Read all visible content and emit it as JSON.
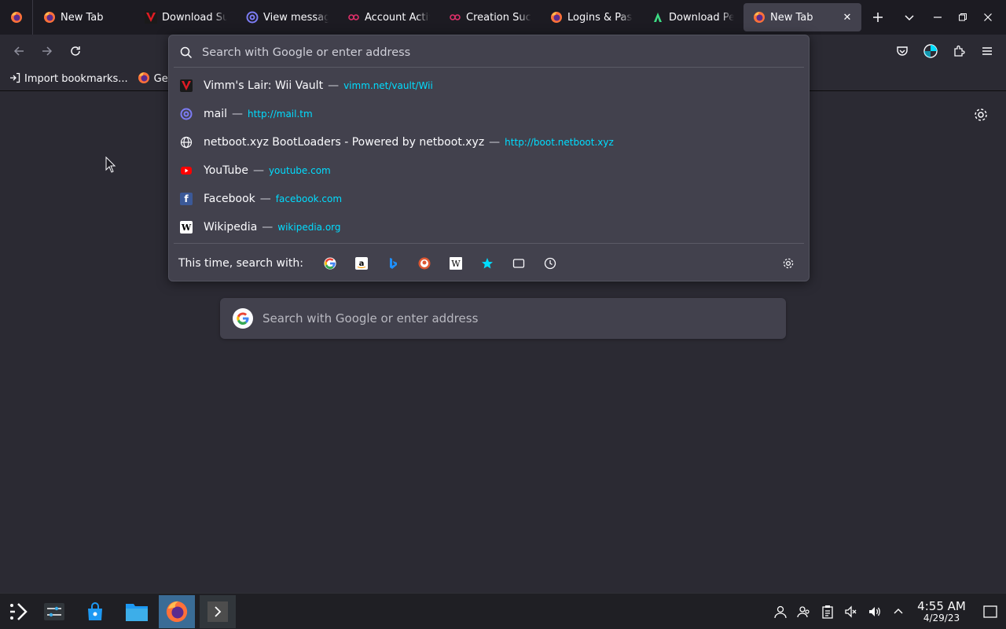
{
  "tabs": [
    {
      "title": "New Tab",
      "icon": "firefox-icon"
    },
    {
      "title": "Download Su",
      "icon": "vimm-icon"
    },
    {
      "title": "View messag",
      "icon": "mail-at-icon"
    },
    {
      "title": "Account Activ",
      "icon": "link-icon"
    },
    {
      "title": "Creation Succ",
      "icon": "link-icon"
    },
    {
      "title": "Logins & Pas",
      "icon": "firefox-icon"
    },
    {
      "title": "Download Pe",
      "icon": "android-icon"
    },
    {
      "title": "New Tab",
      "icon": "firefox-icon",
      "active": true
    }
  ],
  "urlbar": {
    "placeholder": "Search with Google or enter address"
  },
  "bookmarks": [
    {
      "label": "Import bookmarks..."
    },
    {
      "label": "Get"
    }
  ],
  "results": [
    {
      "title": "Vimm's Lair: Wii Vault",
      "url": "vimm.net/vault/Wii",
      "icon": "vimm-icon"
    },
    {
      "title": "mail",
      "url": "http://mail.tm",
      "icon": "mail-at-icon"
    },
    {
      "title": "netboot.xyz BootLoaders - Powered by netboot.xyz",
      "url": "http://boot.netboot.xyz",
      "icon": "globe-icon"
    },
    {
      "title": "YouTube",
      "url": "youtube.com",
      "icon": "youtube-icon"
    },
    {
      "title": "Facebook",
      "url": "facebook.com",
      "icon": "facebook-icon"
    },
    {
      "title": "Wikipedia",
      "url": "wikipedia.org",
      "icon": "wikipedia-icon"
    }
  ],
  "search_with": {
    "label": "This time, search with:",
    "separator": "—"
  },
  "newtab": {
    "search_placeholder": "Search with Google or enter address"
  },
  "clock": {
    "time": "4:55 AM",
    "date": "4/29/23"
  },
  "colors": {
    "accent": "#00ddff",
    "taskbar_active": "#3a6c96"
  }
}
